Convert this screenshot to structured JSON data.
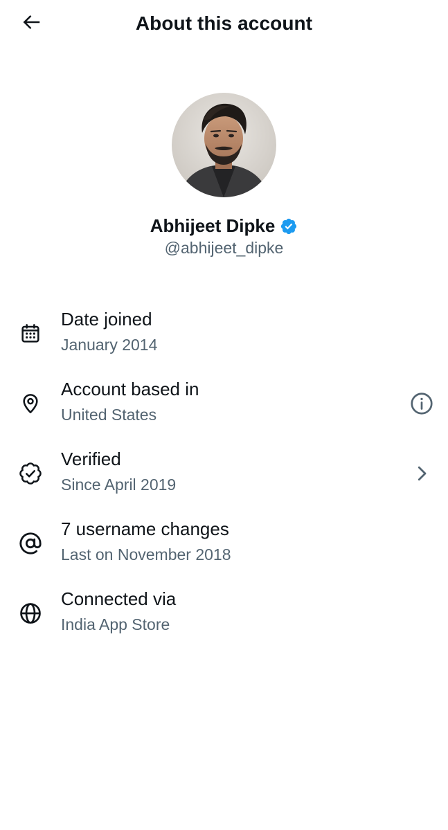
{
  "header": {
    "title": "About this account",
    "back_icon": "arrow-left-icon"
  },
  "profile": {
    "name": "Abhijeet Dipke",
    "handle": "@abhijeet_dipke",
    "verified": true,
    "badge_color": "#1d9bf0",
    "avatar_icon": "profile-photo"
  },
  "rows": [
    {
      "icon": "calendar-icon",
      "label": "Date joined",
      "value": "January 2014"
    },
    {
      "icon": "location-pin-icon",
      "label": "Account based in",
      "value": "United States",
      "trailing_icon": "info-icon"
    },
    {
      "icon": "verified-badge-outline-icon",
      "label": "Verified",
      "value": "Since April 2019",
      "trailing_icon": "chevron-right-icon"
    },
    {
      "icon": "at-sign-icon",
      "label": "7 username changes",
      "value": "Last on November 2018"
    },
    {
      "icon": "globe-icon",
      "label": "Connected via",
      "value": "India App Store"
    }
  ],
  "colors": {
    "text_primary": "#0f1419",
    "text_secondary": "#536471",
    "background": "#ffffff",
    "accent": "#1d9bf0"
  }
}
